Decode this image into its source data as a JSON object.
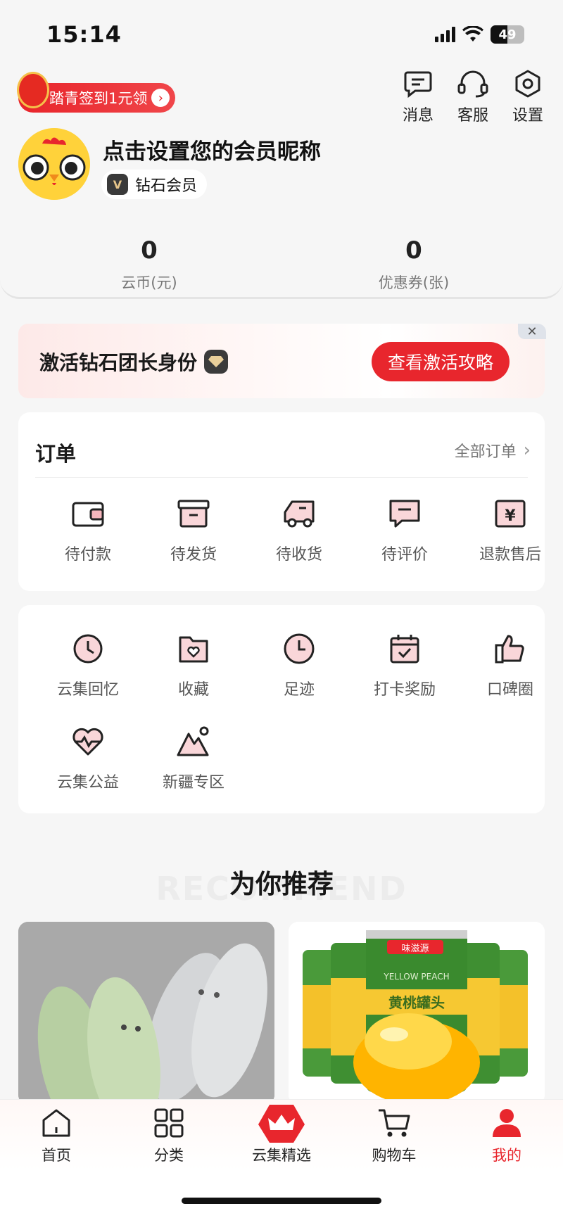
{
  "status_bar": {
    "time": "15:14",
    "battery": "49"
  },
  "header": {
    "checkin_label": "踏青签到1元领",
    "messages_label": "消息",
    "service_label": "客服",
    "settings_label": "设置",
    "nickname": "点击设置您的会员昵称",
    "member_level": "钻石会员",
    "member_badge_letter": "V"
  },
  "stats": [
    {
      "value": "0",
      "label": "云币(元)"
    },
    {
      "value": "0",
      "label": "优惠券(张)"
    }
  ],
  "banner": {
    "title": "激活钻石团长身份",
    "button": "查看激活攻略"
  },
  "orders": {
    "title": "订单",
    "all_link": "全部订单",
    "items": [
      {
        "label": "待付款",
        "icon": "wallet-icon"
      },
      {
        "label": "待发货",
        "icon": "box-icon"
      },
      {
        "label": "待收货",
        "icon": "truck-icon"
      },
      {
        "label": "待评价",
        "icon": "comment-icon"
      },
      {
        "label": "退款售后",
        "icon": "refund-icon"
      }
    ]
  },
  "services": {
    "items": [
      {
        "label": "云集回忆",
        "icon": "history-icon"
      },
      {
        "label": "收藏",
        "icon": "favorite-folder-icon"
      },
      {
        "label": "足迹",
        "icon": "clock-icon"
      },
      {
        "label": "打卡奖励",
        "icon": "calendar-check-icon"
      },
      {
        "label": "口碑圈",
        "icon": "thumbs-up-icon"
      },
      {
        "label": "云集公益",
        "icon": "heart-pulse-icon"
      },
      {
        "label": "新疆专区",
        "icon": "mountain-icon"
      }
    ]
  },
  "recommend": {
    "title": "为你推荐",
    "bg_text": "RECOMMEND",
    "products": [
      {
        "image": "slippers-product-image"
      },
      {
        "image": "yellow-peach-can-product-image",
        "brand_text": "味滋源",
        "en_text": "YELLOW PEACH",
        "cn_text": "黄桃罐头"
      }
    ]
  },
  "tabbar": {
    "tabs": [
      {
        "label": "首页",
        "icon": "home-icon"
      },
      {
        "label": "分类",
        "icon": "grid-icon"
      },
      {
        "label": "云集精选",
        "icon": "crown-icon"
      },
      {
        "label": "购物车",
        "icon": "cart-icon"
      },
      {
        "label": "我的",
        "icon": "profile-icon",
        "active": true
      }
    ]
  },
  "colors": {
    "accent": "#e8262d",
    "active_tab": "#e8262d"
  }
}
